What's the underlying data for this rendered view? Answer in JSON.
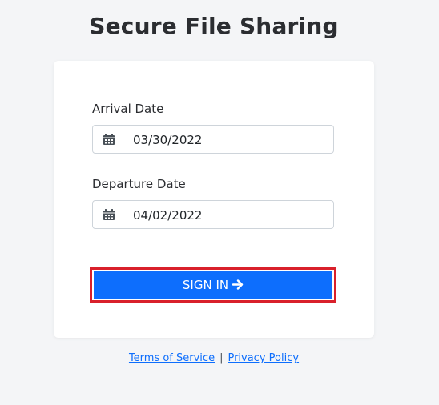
{
  "page": {
    "title": "Secure File Sharing"
  },
  "form": {
    "arrival": {
      "label": "Arrival Date",
      "value": "03/30/2022",
      "icon": "calendar-icon"
    },
    "departure": {
      "label": "Departure Date",
      "value": "04/02/2022",
      "icon": "calendar-icon"
    },
    "submit": {
      "label": "SIGN IN",
      "icon": "arrow-right-icon"
    }
  },
  "footer": {
    "terms": "Terms of Service",
    "separator": "|",
    "privacy": "Privacy Policy"
  },
  "colors": {
    "background": "#f4f5f7",
    "primary": "#0d6efd",
    "highlight": "#d9202b"
  }
}
